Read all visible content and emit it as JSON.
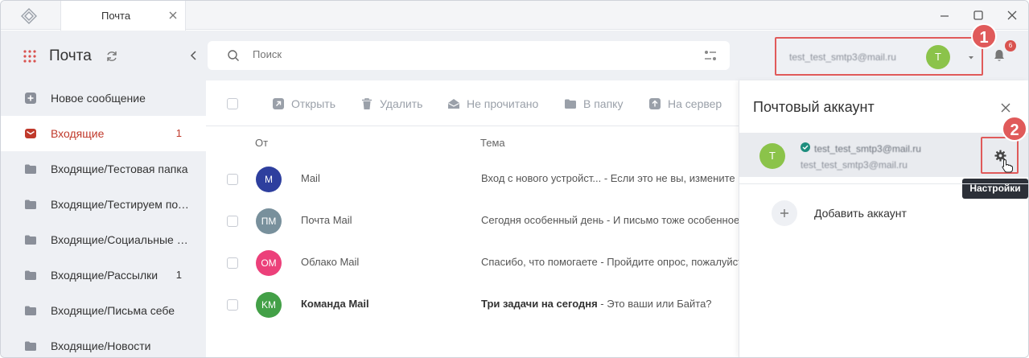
{
  "tab": {
    "title": "Почта"
  },
  "sidebar": {
    "title": "Почта",
    "items": [
      {
        "label": "Новое сообщение",
        "count": "",
        "icon": "plus-square-icon"
      },
      {
        "label": "Входящие",
        "count": "1",
        "icon": "mail-icon"
      },
      {
        "label": "Входящие/Тестовая папка",
        "count": "",
        "icon": "folder-icon"
      },
      {
        "label": "Входящие/Тестируем почту",
        "count": "",
        "icon": "folder-icon"
      },
      {
        "label": "Входящие/Социальные сети",
        "count": "",
        "icon": "folder-icon"
      },
      {
        "label": "Входящие/Рассылки",
        "count": "1",
        "icon": "folder-icon"
      },
      {
        "label": "Входящие/Письма себе",
        "count": "",
        "icon": "folder-icon"
      },
      {
        "label": "Входящие/Новости",
        "count": "",
        "icon": "folder-icon"
      }
    ]
  },
  "search": {
    "placeholder": "Поиск"
  },
  "account": {
    "email": "test_test_smtp3@mail.ru",
    "avatar": "T"
  },
  "notifications": {
    "count": "6"
  },
  "callouts": {
    "first": "1",
    "second": "2"
  },
  "toolbar": {
    "open": "Открыть",
    "delete": "Удалить",
    "unread": "Не прочитано",
    "to_folder": "В папку",
    "to_server": "На сервер"
  },
  "columns": {
    "from": "От",
    "subject": "Тема"
  },
  "messages": [
    {
      "initials": "M",
      "color": "#2e3f9e",
      "from": "Mail",
      "subject": "Вход с нового устройст...",
      "preview": " - Если это не вы, измените пароль",
      "unread": false
    },
    {
      "initials": "ПМ",
      "color": "#78909c",
      "from": "Почта Mail",
      "subject": "Сегодня особенный день",
      "preview": " - И письмо тоже особенное",
      "unread": false
    },
    {
      "initials": "OM",
      "color": "#ec407a",
      "from": "Облако Mail",
      "subject": "Спасибо, что помогаете",
      "preview": " - Пройдите опрос, пожалуйста",
      "unread": false
    },
    {
      "initials": "KM",
      "color": "#43a047",
      "from": "Команда Mail",
      "subject": "Три задачи на сегодня",
      "preview": " - Это ваши или Байта?",
      "unread": true
    }
  ],
  "panel": {
    "title": "Почтовый аккаунт",
    "account_email": "test_test_smtp3@mail.ru",
    "account_sub": "test_test_smtp3@mail.ru",
    "avatar": "T",
    "tooltip": "Настройки",
    "add_label": "Добавить аккаунт"
  },
  "colors": {
    "accent": "#c0392b",
    "callout": "#e05a5a",
    "avatar_green": "#8bc34a"
  }
}
